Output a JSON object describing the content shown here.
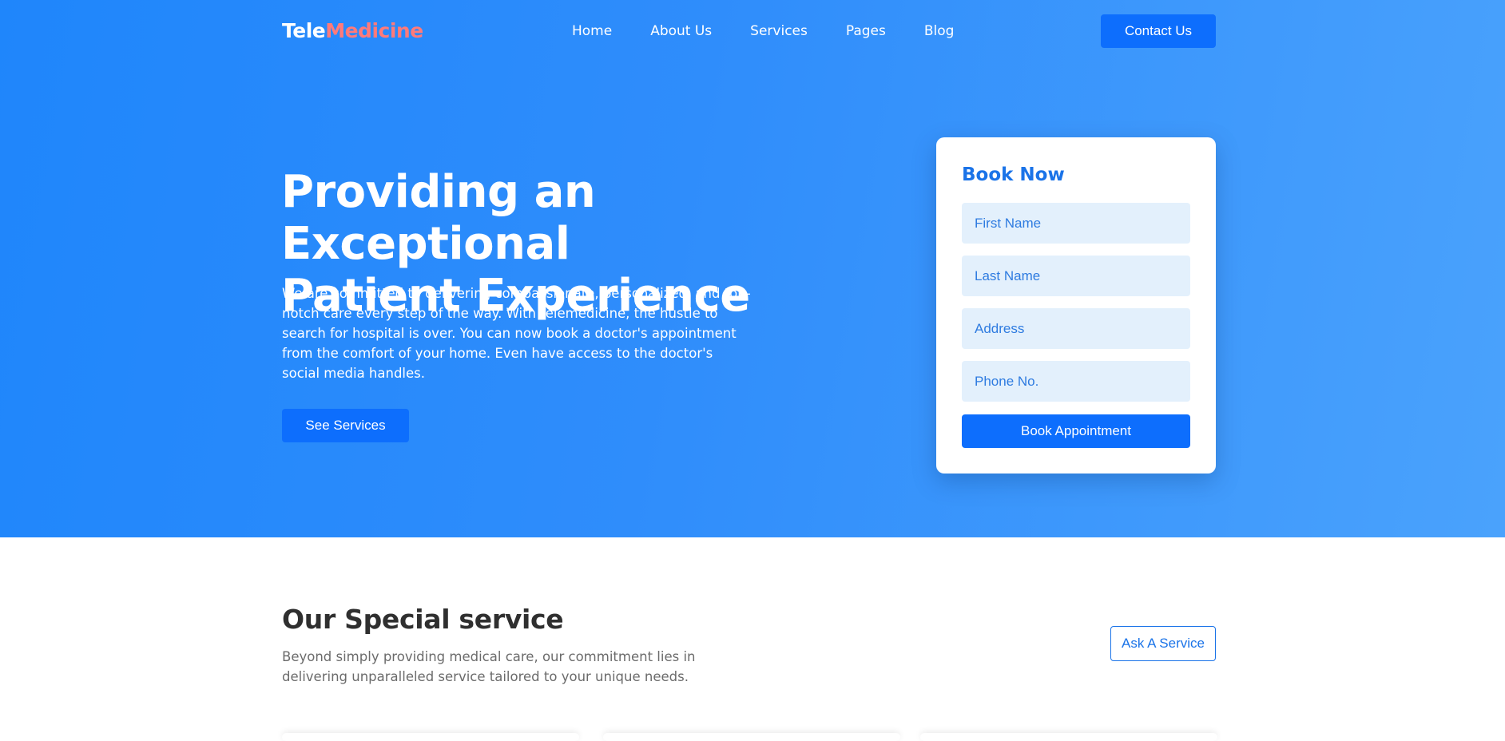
{
  "brand": {
    "part1": "Tele",
    "part2": "Medicine"
  },
  "nav": {
    "items": [
      "Home",
      "About Us",
      "Services",
      "Pages",
      "Blog"
    ],
    "contact_label": "Contact Us"
  },
  "hero": {
    "title_line1": "Providing an Exceptional",
    "title_line2": "Patient Experience",
    "description": "We are committed to delivering compassionate, personalized, and top-notch care every step of the way. With telemedicine, the hustle to search for hospital is over. You can now book a doctor's appointment from the comfort of your home. Even have access to the doctor's social media handles.",
    "cta_label": "See Services"
  },
  "booking": {
    "title": "Book Now",
    "fields": [
      {
        "placeholder": "First Name"
      },
      {
        "placeholder": "Last Name"
      },
      {
        "placeholder": "Address"
      },
      {
        "placeholder": "Phone No."
      }
    ],
    "submit_label": "Book Appointment"
  },
  "special": {
    "title": "Our Special service",
    "subtitle": "Beyond simply providing medical care, our commitment lies in delivering unparalleled service tailored to your unique needs.",
    "button_label": "Ask A Service"
  },
  "colors": {
    "hero_start": "#1f86fb",
    "hero_end": "#4aa2fc",
    "primary_button": "#0d6efd",
    "brand_accent": "#ff7a7a",
    "input_bg": "#e3f0fc"
  }
}
